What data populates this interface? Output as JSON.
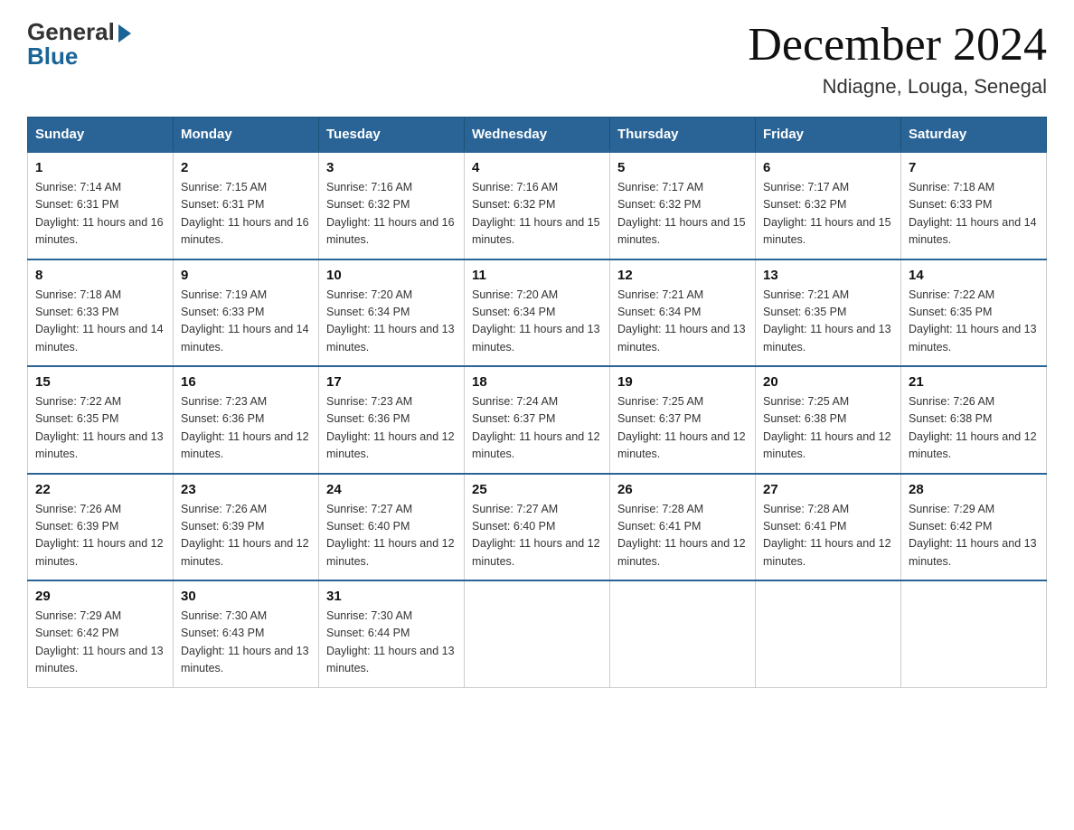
{
  "logo": {
    "general": "General",
    "blue": "Blue"
  },
  "header": {
    "month": "December 2024",
    "location": "Ndiagne, Louga, Senegal"
  },
  "days_of_week": [
    "Sunday",
    "Monday",
    "Tuesday",
    "Wednesday",
    "Thursday",
    "Friday",
    "Saturday"
  ],
  "weeks": [
    [
      {
        "day": "1",
        "sunrise": "7:14 AM",
        "sunset": "6:31 PM",
        "daylight": "11 hours and 16 minutes."
      },
      {
        "day": "2",
        "sunrise": "7:15 AM",
        "sunset": "6:31 PM",
        "daylight": "11 hours and 16 minutes."
      },
      {
        "day": "3",
        "sunrise": "7:16 AM",
        "sunset": "6:32 PM",
        "daylight": "11 hours and 16 minutes."
      },
      {
        "day": "4",
        "sunrise": "7:16 AM",
        "sunset": "6:32 PM",
        "daylight": "11 hours and 15 minutes."
      },
      {
        "day": "5",
        "sunrise": "7:17 AM",
        "sunset": "6:32 PM",
        "daylight": "11 hours and 15 minutes."
      },
      {
        "day": "6",
        "sunrise": "7:17 AM",
        "sunset": "6:32 PM",
        "daylight": "11 hours and 15 minutes."
      },
      {
        "day": "7",
        "sunrise": "7:18 AM",
        "sunset": "6:33 PM",
        "daylight": "11 hours and 14 minutes."
      }
    ],
    [
      {
        "day": "8",
        "sunrise": "7:18 AM",
        "sunset": "6:33 PM",
        "daylight": "11 hours and 14 minutes."
      },
      {
        "day": "9",
        "sunrise": "7:19 AM",
        "sunset": "6:33 PM",
        "daylight": "11 hours and 14 minutes."
      },
      {
        "day": "10",
        "sunrise": "7:20 AM",
        "sunset": "6:34 PM",
        "daylight": "11 hours and 13 minutes."
      },
      {
        "day": "11",
        "sunrise": "7:20 AM",
        "sunset": "6:34 PM",
        "daylight": "11 hours and 13 minutes."
      },
      {
        "day": "12",
        "sunrise": "7:21 AM",
        "sunset": "6:34 PM",
        "daylight": "11 hours and 13 minutes."
      },
      {
        "day": "13",
        "sunrise": "7:21 AM",
        "sunset": "6:35 PM",
        "daylight": "11 hours and 13 minutes."
      },
      {
        "day": "14",
        "sunrise": "7:22 AM",
        "sunset": "6:35 PM",
        "daylight": "11 hours and 13 minutes."
      }
    ],
    [
      {
        "day": "15",
        "sunrise": "7:22 AM",
        "sunset": "6:35 PM",
        "daylight": "11 hours and 13 minutes."
      },
      {
        "day": "16",
        "sunrise": "7:23 AM",
        "sunset": "6:36 PM",
        "daylight": "11 hours and 12 minutes."
      },
      {
        "day": "17",
        "sunrise": "7:23 AM",
        "sunset": "6:36 PM",
        "daylight": "11 hours and 12 minutes."
      },
      {
        "day": "18",
        "sunrise": "7:24 AM",
        "sunset": "6:37 PM",
        "daylight": "11 hours and 12 minutes."
      },
      {
        "day": "19",
        "sunrise": "7:25 AM",
        "sunset": "6:37 PM",
        "daylight": "11 hours and 12 minutes."
      },
      {
        "day": "20",
        "sunrise": "7:25 AM",
        "sunset": "6:38 PM",
        "daylight": "11 hours and 12 minutes."
      },
      {
        "day": "21",
        "sunrise": "7:26 AM",
        "sunset": "6:38 PM",
        "daylight": "11 hours and 12 minutes."
      }
    ],
    [
      {
        "day": "22",
        "sunrise": "7:26 AM",
        "sunset": "6:39 PM",
        "daylight": "11 hours and 12 minutes."
      },
      {
        "day": "23",
        "sunrise": "7:26 AM",
        "sunset": "6:39 PM",
        "daylight": "11 hours and 12 minutes."
      },
      {
        "day": "24",
        "sunrise": "7:27 AM",
        "sunset": "6:40 PM",
        "daylight": "11 hours and 12 minutes."
      },
      {
        "day": "25",
        "sunrise": "7:27 AM",
        "sunset": "6:40 PM",
        "daylight": "11 hours and 12 minutes."
      },
      {
        "day": "26",
        "sunrise": "7:28 AM",
        "sunset": "6:41 PM",
        "daylight": "11 hours and 12 minutes."
      },
      {
        "day": "27",
        "sunrise": "7:28 AM",
        "sunset": "6:41 PM",
        "daylight": "11 hours and 12 minutes."
      },
      {
        "day": "28",
        "sunrise": "7:29 AM",
        "sunset": "6:42 PM",
        "daylight": "11 hours and 13 minutes."
      }
    ],
    [
      {
        "day": "29",
        "sunrise": "7:29 AM",
        "sunset": "6:42 PM",
        "daylight": "11 hours and 13 minutes."
      },
      {
        "day": "30",
        "sunrise": "7:30 AM",
        "sunset": "6:43 PM",
        "daylight": "11 hours and 13 minutes."
      },
      {
        "day": "31",
        "sunrise": "7:30 AM",
        "sunset": "6:44 PM",
        "daylight": "11 hours and 13 minutes."
      },
      null,
      null,
      null,
      null
    ]
  ]
}
